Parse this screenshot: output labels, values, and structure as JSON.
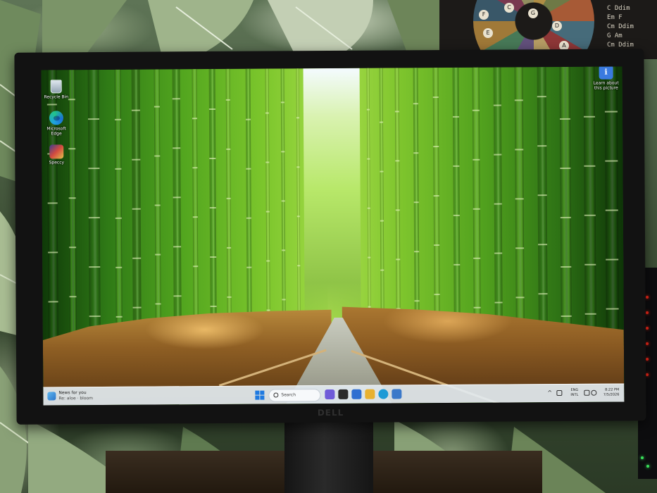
{
  "desktop": {
    "icons": [
      {
        "id": "recycle-bin",
        "label": "Recycle Bin",
        "icon": "recycle-bin-icon"
      },
      {
        "id": "microsoft-edge",
        "label": "Microsoft Edge",
        "icon": "edge-browser-icon"
      },
      {
        "id": "speccy",
        "label": "Speccy",
        "icon": "speccy-icon"
      }
    ],
    "spotlight": {
      "label": "Learn about this picture",
      "icon": "info-icon",
      "glyph": "i"
    }
  },
  "taskbar": {
    "widget": {
      "title": "News for you",
      "subtitle": "Re: aloe · bloom",
      "icon": "widgets-icon"
    },
    "start": {
      "icon": "windows-start-icon"
    },
    "search": {
      "placeholder": "Search",
      "icon": "search-icon"
    },
    "apps": [
      {
        "id": "widget-app",
        "icon": "copilot-icon",
        "color": "#6f5bd8"
      },
      {
        "id": "task-view",
        "icon": "task-view-icon",
        "color": "#2b2b2b"
      },
      {
        "id": "store",
        "icon": "store-icon",
        "color": "#2f6fd1"
      },
      {
        "id": "explorer",
        "icon": "file-explorer-icon",
        "color": "#e8b130"
      },
      {
        "id": "edge",
        "icon": "edge-browser-icon",
        "color": "#1e9ad6"
      },
      {
        "id": "monitor-app",
        "icon": "system-monitor-icon",
        "color": "#3b78c9"
      }
    ],
    "tray": {
      "chevron": "^",
      "lang_top": "ENG",
      "lang_bottom": "INTL",
      "time": "8:22 PM",
      "date": "7/5/2026"
    }
  },
  "monitor": {
    "brand": "DELL"
  },
  "wall_chart": {
    "wheel_notes": [
      "C",
      "G",
      "D",
      "A",
      "E",
      "F"
    ],
    "chords": [
      "C  Ddim",
      "Em  F",
      "Cm Ddim",
      "G   Am",
      "Cm Ddim"
    ]
  }
}
